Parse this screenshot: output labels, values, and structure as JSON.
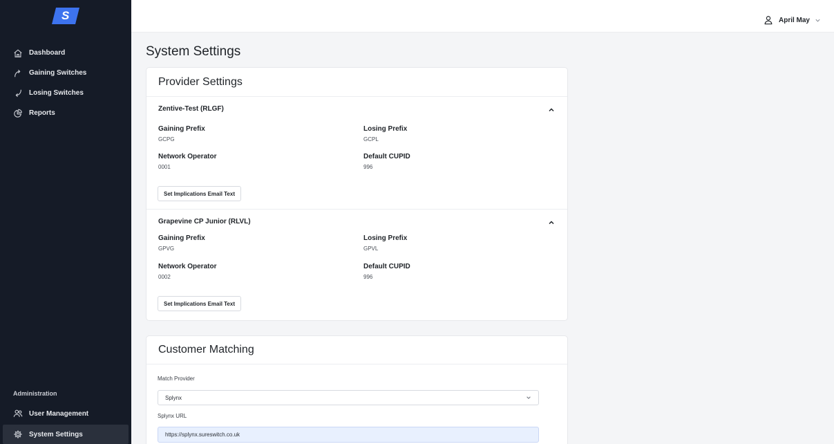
{
  "brand": {
    "logo_letter": "S",
    "accent": "#3d73ee"
  },
  "sidebar": {
    "items": [
      {
        "label": "Dashboard",
        "icon": "home-icon"
      },
      {
        "label": "Gaining Switches",
        "icon": "arrow-up-curve-icon"
      },
      {
        "label": "Losing Switches",
        "icon": "arrow-down-curve-icon"
      },
      {
        "label": "Reports",
        "icon": "pie-chart-icon"
      }
    ],
    "admin_title": "Administration",
    "admin_items": [
      {
        "label": "User Management",
        "icon": "users-icon"
      },
      {
        "label": "System Settings",
        "icon": "gear-icon",
        "active": true
      }
    ]
  },
  "header": {
    "user_name": "April May"
  },
  "page": {
    "title": "System Settings"
  },
  "provider_settings": {
    "title": "Provider Settings",
    "providers": [
      {
        "name": "Zentive-Test (RLGF)",
        "gaining_prefix_label": "Gaining Prefix",
        "gaining_prefix": "GCPG",
        "losing_prefix_label": "Losing Prefix",
        "losing_prefix": "GCPL",
        "network_operator_label": "Network Operator",
        "network_operator": "0001",
        "default_cupid_label": "Default CUPID",
        "default_cupid": "996",
        "button_label": "Set Implications Email Text"
      },
      {
        "name": "Grapevine CP Junior (RLVL)",
        "gaining_prefix_label": "Gaining Prefix",
        "gaining_prefix": "GPVG",
        "losing_prefix_label": "Losing Prefix",
        "losing_prefix": "GPVL",
        "network_operator_label": "Network Operator",
        "network_operator": "0002",
        "default_cupid_label": "Default CUPID",
        "default_cupid": "996",
        "button_label": "Set Implications Email Text"
      }
    ]
  },
  "customer_matching": {
    "title": "Customer Matching",
    "match_provider_label": "Match Provider",
    "match_provider_value": "Splynx",
    "url_label": "Splynx URL",
    "url_value": "https://splynx.sureswitch.co.uk"
  }
}
